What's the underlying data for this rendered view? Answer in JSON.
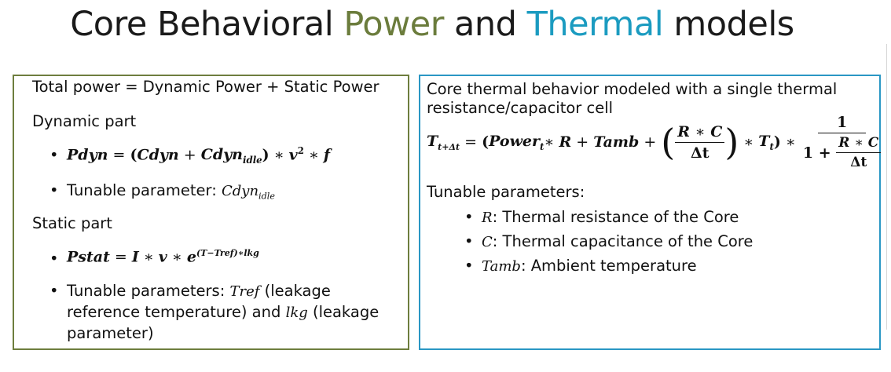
{
  "title": {
    "part1": "Core Behavioral ",
    "power": "Power",
    "part2": " and ",
    "thermal": "Thermal",
    "part3": " models"
  },
  "left": {
    "line1": "Total power = Dynamic Power + Static Power",
    "dynamic_heading": "Dynamic part",
    "tunable_label": "Tunable parameter: ",
    "static_heading": "Static part",
    "tunable_params_label": "Tunable parameters: ",
    "tref_desc_1": " (leakage",
    "tref_desc_2": "reference temperature) and ",
    "lkg_desc": " (leakage",
    "tref_desc_3": "parameter)"
  },
  "right": {
    "line1": "Core thermal behavior modeled with a single thermal",
    "line2": "resistance/capacitor cell",
    "tunable_heading": "Tunable parameters:",
    "param_r": ": Thermal resistance of the Core",
    "param_c": ": Thermal capacitance of the Core",
    "param_tamb": ": Ambient temperature"
  },
  "colors": {
    "power": "#6b7c3c",
    "thermal": "#1b9bc0",
    "left_border": "#6e7e3e",
    "right_border": "#2a97c4"
  }
}
